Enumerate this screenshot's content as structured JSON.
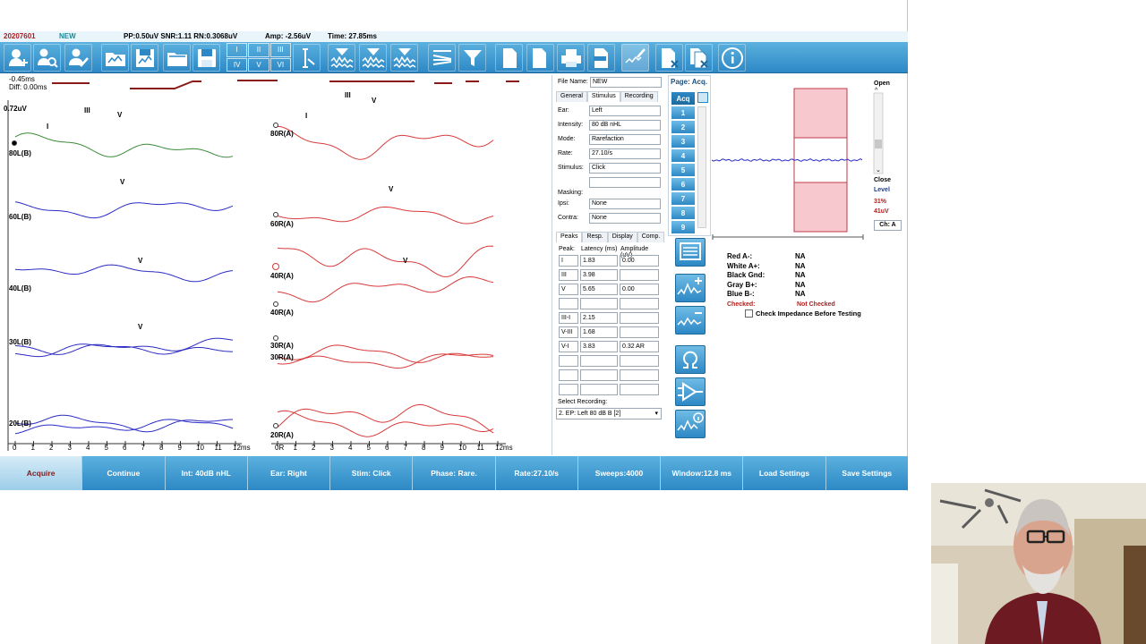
{
  "titlebar": {
    "record_id": "20207601",
    "status": "NEW",
    "metrics": "PP:0.50uV SNR:1.11 RN:0.3068uV",
    "amp": "Amp: -2.56uV",
    "time": "Time: 27.85ms",
    "cursor_a": "-0.45ms",
    "diff": "Diff: 0.00ms",
    "scale": "0.72uV"
  },
  "toolbar": {
    "grid_labels": [
      "I",
      "II",
      "III",
      "IV",
      "V",
      "VI"
    ],
    "icons": [
      "add-patient-icon",
      "search-patient-icon",
      "edit-patient-icon",
      "open-folder-icon",
      "save-icon",
      "folder-icon",
      "disk-icon",
      "cursor-icon",
      "db-wave-icon",
      "123-wave-icon",
      "abc-wave-icon",
      "filter-lines-icon",
      "funnel-icon",
      "document-icon",
      "abc-doc-icon",
      "printer-icon",
      "pdf-icon",
      "pen-wave-icon",
      "delete-doc-icon",
      "delete-doc2-icon",
      "info-icon"
    ]
  },
  "waves": {
    "left_labels": [
      "80L(B)",
      "60L(B)",
      "40L(B)",
      "30L(B)",
      "20L(B)"
    ],
    "right_labels": [
      "80R(A)",
      "60R(A)",
      "40R(A)",
      "40R(A)",
      "30R(A)",
      "30R(A)",
      "20R(A)"
    ],
    "axis_ticks": [
      "0",
      "1",
      "2",
      "3",
      "4",
      "5",
      "6",
      "7",
      "8",
      "9",
      "10",
      "11",
      "12ms"
    ],
    "axis_zero_right": "0R",
    "peaks": {
      "i": "I",
      "iii": "III",
      "v": "V"
    },
    "colors": {
      "left": "#2b2bc4",
      "green": "#3a8a3a",
      "right": "#d83a3a",
      "marker": "#8b1a1a"
    }
  },
  "side": {
    "file_name_label": "File Name:",
    "file_name": "NEW",
    "tabs": [
      "General",
      "Stimulus",
      "Recording"
    ],
    "fields": [
      {
        "k": "Ear:",
        "v": "Left"
      },
      {
        "k": "Intensity:",
        "v": "80 dB nHL"
      },
      {
        "k": "Mode:",
        "v": "Rarefaction"
      },
      {
        "k": "Rate:",
        "v": "27.10/s"
      },
      {
        "k": "Stimulus:",
        "v": "Click"
      },
      {
        "k": "",
        "v": ""
      }
    ],
    "masking_label": "Masking:",
    "masking": [
      {
        "k": "Ipsi:",
        "v": "None"
      },
      {
        "k": "Contra:",
        "v": "None"
      }
    ],
    "peak_tabs": [
      "Peaks",
      "Resp.",
      "Display",
      "Comp."
    ],
    "peak_headers": [
      "Peak:",
      "Latency (ms)",
      "Amplitude (uV)"
    ],
    "peaks": [
      {
        "p": "I",
        "l": "1.83",
        "a": "0.00"
      },
      {
        "p": "III",
        "l": "3.98",
        "a": ""
      },
      {
        "p": "V",
        "l": "5.65",
        "a": "0.00"
      },
      {
        "p": "",
        "l": "",
        "a": ""
      },
      {
        "p": "III-I",
        "l": "2.15",
        "a": ""
      },
      {
        "p": "V-III",
        "l": "1.68",
        "a": ""
      },
      {
        "p": "V-I",
        "l": "3.83",
        "a": "0.32 AR"
      },
      {
        "p": "",
        "l": "",
        "a": ""
      },
      {
        "p": "",
        "l": "",
        "a": ""
      },
      {
        "p": "",
        "l": "",
        "a": ""
      }
    ],
    "select_label": "Select Recording:",
    "select_value": "2. EP: Left 80 dB B [2]"
  },
  "pages": {
    "title": "Page: Acq.",
    "acq": "Acq",
    "numbers": [
      "1",
      "2",
      "3",
      "4",
      "5",
      "6",
      "7",
      "8",
      "9"
    ]
  },
  "meter": {
    "open": "Open",
    "close": "Close",
    "level": "Level",
    "percent": "31%",
    "uv": "41uV",
    "channel": "Ch: A"
  },
  "impedance": {
    "rows": [
      {
        "k": "Red A-:",
        "v": "NA"
      },
      {
        "k": "White A+:",
        "v": "NA"
      },
      {
        "k": "Black Gnd:",
        "v": "NA"
      },
      {
        "k": "Gray B+:",
        "v": "NA"
      },
      {
        "k": "Blue B-:",
        "v": "NA"
      }
    ],
    "checked_label": "Checked:",
    "checked_value": "Not Checked",
    "check_option": "Check Impedance Before Testing"
  },
  "bottom": [
    "Acquire",
    "Continue",
    "Int: 40dB nHL",
    "Ear: Right",
    "Stim: Click",
    "Phase: Rare.",
    "Rate:27.10/s",
    "Sweeps:4000",
    "Window:12.8 ms",
    "Load Settings",
    "Save Settings"
  ]
}
